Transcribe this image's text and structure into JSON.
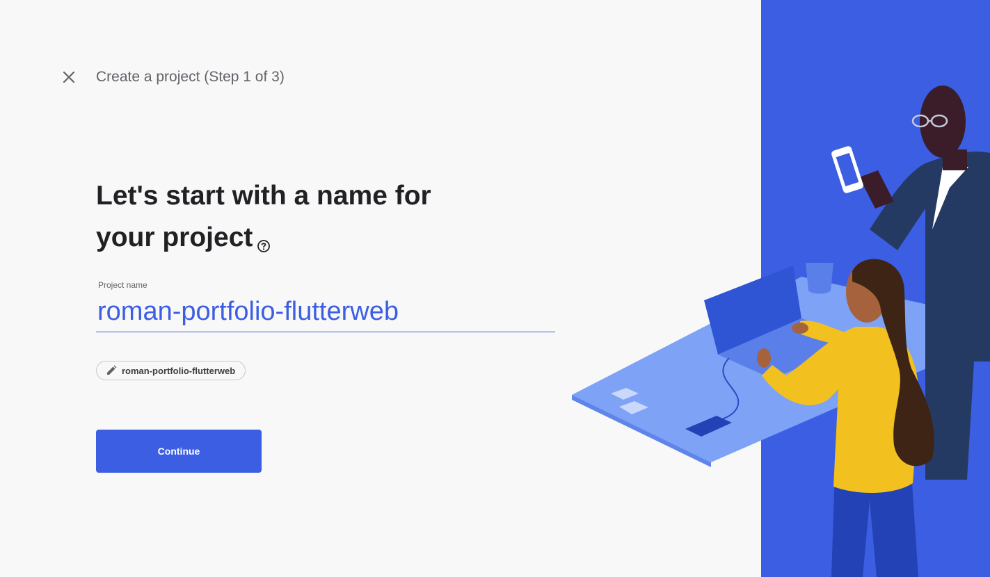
{
  "header": {
    "close_icon": "close-icon",
    "step_title": "Create a project (Step 1 of 3)"
  },
  "main": {
    "heading_line1": "Let's start with a name for",
    "heading_line2": "your project",
    "help_icon": "help-circle-icon",
    "project_name_label": "Project name",
    "project_name_value": "roman-portfolio-flutterweb",
    "project_id_chip": {
      "icon": "pencil-icon",
      "label": "roman-portfolio-flutterweb"
    },
    "continue_label": "Continue"
  },
  "colors": {
    "accent": "#3b5ee3",
    "background": "#f8f8f8",
    "text_primary": "#202124",
    "text_secondary": "#5f6368"
  },
  "illustration": "two-people-working-at-desk"
}
